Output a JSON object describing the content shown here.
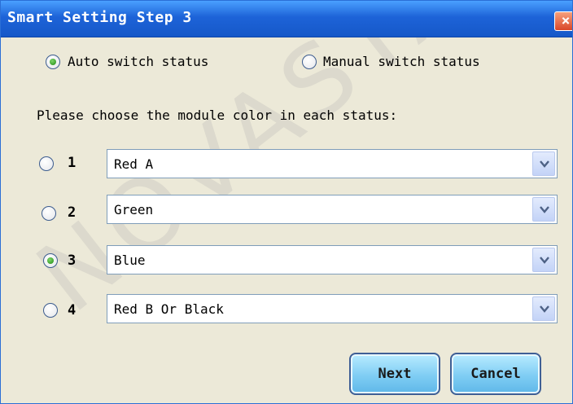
{
  "window": {
    "title": "Smart Setting Step 3",
    "close_icon": "close-icon"
  },
  "mode": {
    "options": [
      {
        "label": "Auto switch status",
        "selected": true
      },
      {
        "label": "Manual switch status",
        "selected": false
      }
    ]
  },
  "prompt": "Please choose the module color in each status:",
  "statuses": [
    {
      "number": "1",
      "selected": false,
      "value": "Red A"
    },
    {
      "number": "2",
      "selected": false,
      "value": "Green"
    },
    {
      "number": "3",
      "selected": true,
      "value": "Blue"
    },
    {
      "number": "4",
      "selected": false,
      "value": "Red B Or Black"
    }
  ],
  "buttons": {
    "next": "Next",
    "cancel": "Cancel"
  },
  "watermark": "NOVASTAR"
}
